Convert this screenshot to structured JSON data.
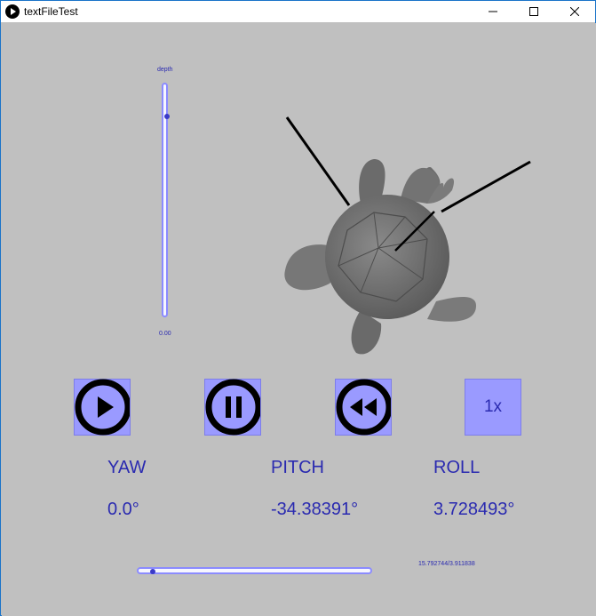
{
  "window": {
    "title": "textFileTest"
  },
  "depth": {
    "label": "depth",
    "value": "0.00",
    "knob_fraction": 0.87
  },
  "controls": {
    "play": "play-icon",
    "pause": "pause-icon",
    "rewind": "rewind-icon",
    "speed_label": "1x"
  },
  "readouts": {
    "yaw_label": "YAW",
    "pitch_label": "PITCH",
    "roll_label": "ROLL",
    "yaw_value": "0.0°",
    "pitch_value": "-34.38391°",
    "roll_value": "3.728493°"
  },
  "timeline": {
    "readout": "15.792744/3.911838",
    "progress_fraction": 0.05
  },
  "colors": {
    "accent": "#9a9aff",
    "text": "#2a2ab0",
    "background": "#c0c0c0"
  }
}
